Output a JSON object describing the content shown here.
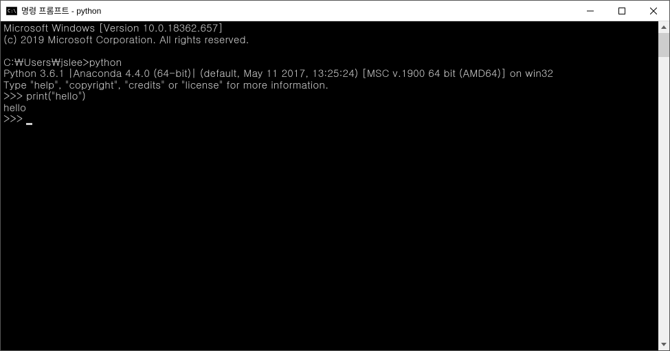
{
  "title": "명령 프롬프트 - python",
  "console": {
    "line1": "Microsoft Windows [Version 10.0.18362.657]",
    "line2": "(c) 2019 Microsoft Corporation. All rights reserved.",
    "blank1": "",
    "path_line": "C:\\Users\\jslee>python",
    "py_version": "Python 3.6.1 |Anaconda 4.4.0 (64-bit)| (default, May 11 2017, 13:25:24) [MSC v.1900 64 bit (AMD64)] on win32",
    "py_help": "Type \"help\", \"copyright\", \"credits\" or \"license\" for more information.",
    "prompt1": ">>> print(\"hello\")",
    "output1": "hello",
    "prompt2": ">>> "
  }
}
